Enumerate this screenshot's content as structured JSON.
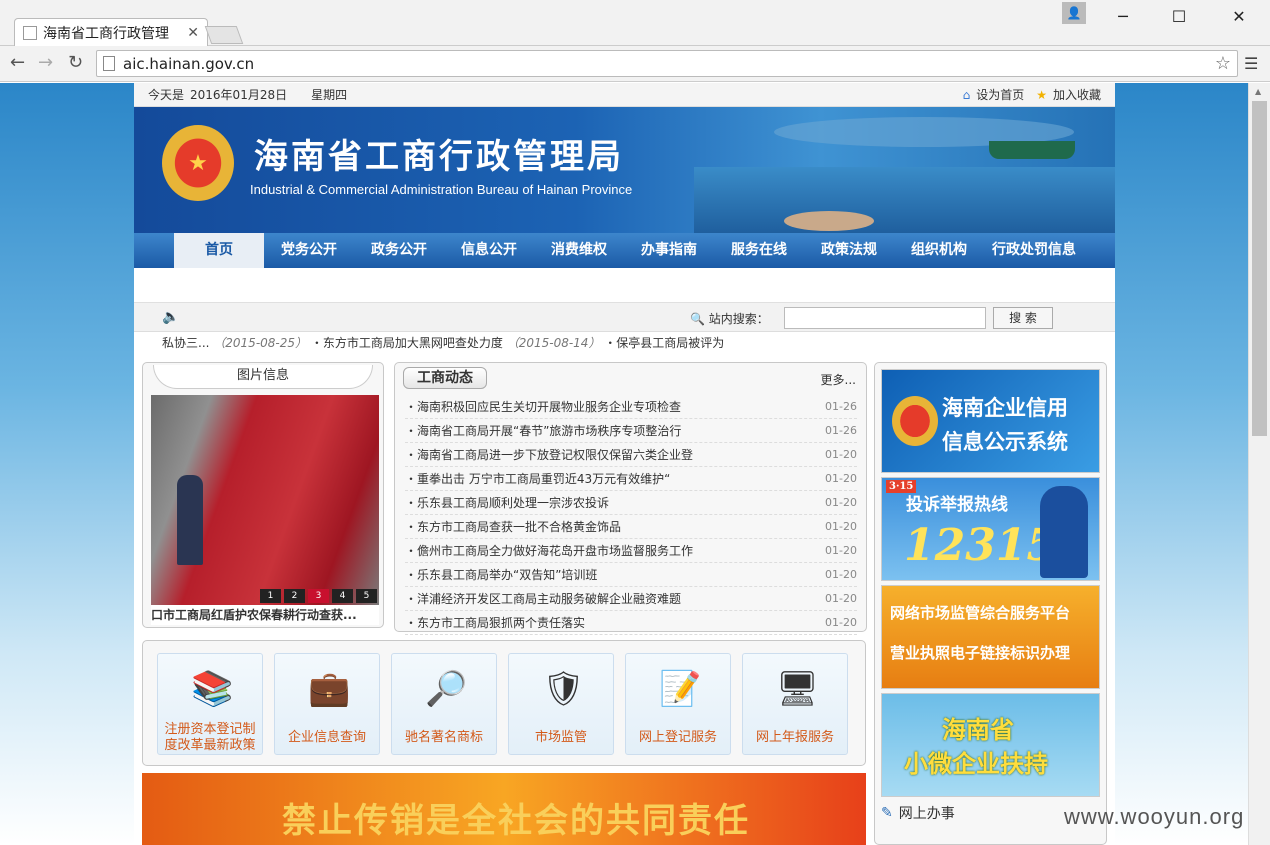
{
  "browser": {
    "tab_title": "海南省工商行政管理",
    "url": "aic.hainan.gov.cn"
  },
  "topbar": {
    "today_label": "今天是",
    "date": "2016年01月28日",
    "weekday": "星期四",
    "set_home": "设为首页",
    "add_fav": "加入收藏"
  },
  "banner": {
    "title": "海南省工商行政管理局",
    "subtitle": "Industrial & Commercial Administration Bureau of Hainan Province"
  },
  "nav": [
    "首页",
    "党务公开",
    "政务公开",
    "信息公开",
    "消费维权",
    "办事指南",
    "服务在线",
    "政策法规",
    "组织机构",
    "行政处罚信息"
  ],
  "search": {
    "label": "站内搜索：",
    "button": "搜 索"
  },
  "ticker": {
    "t1": "私协三...",
    "d1": "（2015-08-25）",
    "t2": "・东方市工商局加大黑网吧查处力度",
    "d2": "（2015-08-14）",
    "t3": "・保亭县工商局被评为"
  },
  "photo": {
    "title": "图片信息",
    "caption": "口市工商局红盾护农保春耕行动查获...",
    "pages": [
      "1",
      "2",
      "3",
      "4",
      "5"
    ]
  },
  "news": {
    "title": "工商动态",
    "more": "更多...",
    "items": [
      {
        "t": "・海南积极回应民生关切开展物业服务企业专项检查",
        "d": "01-26"
      },
      {
        "t": "・海南省工商局开展“春节”旅游市场秩序专项整治行",
        "d": "01-26"
      },
      {
        "t": "・海南省工商局进一步下放登记权限仅保留六类企业登",
        "d": "01-20"
      },
      {
        "t": "・重拳出击 万宁市工商局重罚近43万元有效维护“",
        "d": "01-20"
      },
      {
        "t": "・乐东县工商局顺利处理一宗涉农投诉",
        "d": "01-20"
      },
      {
        "t": "・东方市工商局查获一批不合格黄金饰品",
        "d": "01-20"
      },
      {
        "t": "・儋州市工商局全力做好海花岛开盘市场监督服务工作",
        "d": "01-20"
      },
      {
        "t": "・乐东县工商局举办“双告知”培训班",
        "d": "01-20"
      },
      {
        "t": "・洋浦经济开发区工商局主动服务破解企业融资难题",
        "d": "01-20"
      },
      {
        "t": "・东方市工商局狠抓两个责任落实",
        "d": "01-20"
      }
    ]
  },
  "services": [
    {
      "l1": "注册资本登记制",
      "l2": "度改革最新政策"
    },
    {
      "l1": "企业信息查询",
      "l2": ""
    },
    {
      "l1": "驰名著名商标",
      "l2": ""
    },
    {
      "l1": "市场监管",
      "l2": ""
    },
    {
      "l1": "网上登记服务",
      "l2": ""
    },
    {
      "l1": "网上年报服务",
      "l2": ""
    }
  ],
  "warning_banner": "禁止传销是全社会的共同责任",
  "side": {
    "b1a": "海南企业信用",
    "b1b": "信息公示系统",
    "b2a": "投诉举报热线",
    "b2b": "12315",
    "b2c": "3·15",
    "b3a": "网络市场监管综合服务平台",
    "b3b": "营业执照电子链接标识办理",
    "b4a": "海南省",
    "b4b": "小微企业扶持",
    "online": "网上办事"
  },
  "watermark": "www.wooyun.org"
}
